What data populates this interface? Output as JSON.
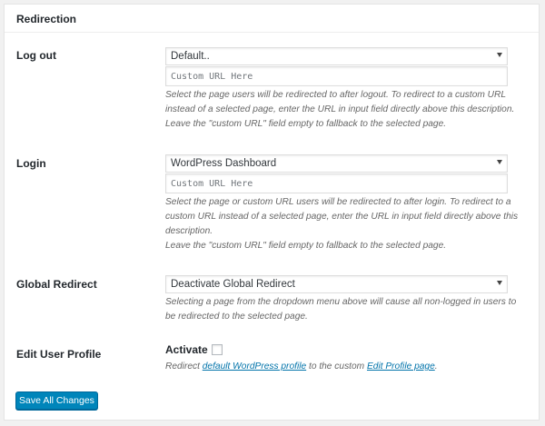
{
  "panel": {
    "title": "Redirection"
  },
  "logout": {
    "label": "Log out",
    "select_value": "Default..",
    "url_placeholder": "Custom URL Here",
    "desc_1": "Select the page users will be redirected to after logout. To redirect to a custom URL instead of a selected page, enter the URL in input field directly above this description.",
    "desc_2": "Leave the \"custom URL\" field empty to fallback to the selected page."
  },
  "login": {
    "label": "Login",
    "select_value": "WordPress Dashboard",
    "url_placeholder": "Custom URL Here",
    "desc_1": "Select the page or custom URL users will be redirected to after login. To redirect to a custom URL instead of a selected page, enter the URL in input field directly above this description.",
    "desc_2": "Leave the \"custom URL\" field empty to fallback to the selected page."
  },
  "global_redirect": {
    "label": "Global Redirect",
    "select_value": "Deactivate Global Redirect",
    "desc": "Selecting a page from the dropdown menu above will cause all non-logged in users to be redirected to the selected page."
  },
  "edit_profile": {
    "label": "Edit User Profile",
    "activate_label": "Activate",
    "checked": false,
    "desc_prefix": "Redirect ",
    "desc_link_1": "default WordPress profile",
    "desc_middle": " to the custom ",
    "desc_link_2": "Edit Profile page",
    "desc_suffix": "."
  },
  "footer": {
    "save_label": "Save All Changes"
  },
  "colors": {
    "primary_button": "#0085ba",
    "link": "#0073aa"
  }
}
